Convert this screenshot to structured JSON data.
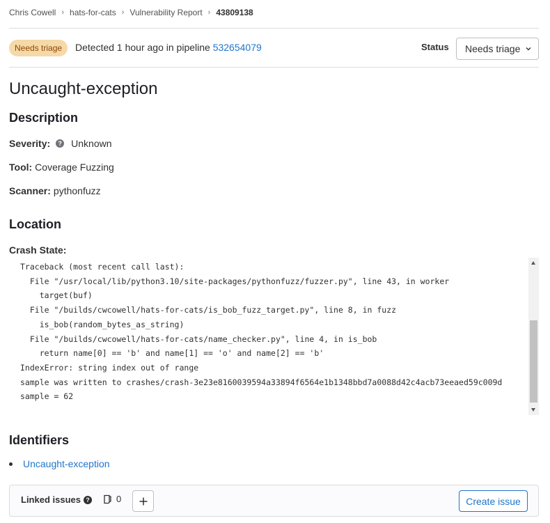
{
  "breadcrumb": [
    "Chris Cowell",
    "hats-for-cats",
    "Vulnerability Report",
    "43809138"
  ],
  "header": {
    "badge": "Needs triage",
    "detected_prefix": "Detected 1 hour ago in pipeline",
    "pipeline_id": "532654079",
    "status_label": "Status",
    "status_value": "Needs triage"
  },
  "title": "Uncaught-exception",
  "description": {
    "heading": "Description",
    "severity_label": "Severity:",
    "severity_value": "Unknown",
    "tool_label": "Tool:",
    "tool_value": "Coverage Fuzzing",
    "scanner_label": "Scanner:",
    "scanner_value": "pythonfuzz"
  },
  "location": {
    "heading": "Location",
    "crash_state_label": "Crash State:",
    "crash_state": "Traceback (most recent call last):\n  File \"/usr/local/lib/python3.10/site-packages/pythonfuzz/fuzzer.py\", line 43, in worker\n    target(buf)\n  File \"/builds/cwcowell/hats-for-cats/is_bob_fuzz_target.py\", line 8, in fuzz\n    is_bob(random_bytes_as_string)\n  File \"/builds/cwcowell/hats-for-cats/name_checker.py\", line 4, in is_bob\n    return name[0] == 'b' and name[1] == 'o' and name[2] == 'b'\nIndexError: string index out of range\nsample was written to crashes/crash-3e23e8160039594a33894f6564e1b1348bbd7a0088d42c4acb73eeaed59c009d\nsample = 62"
  },
  "identifiers": {
    "heading": "Identifiers",
    "items": [
      "Uncaught-exception"
    ]
  },
  "linked_issues": {
    "label": "Linked issues",
    "count": "0",
    "create_label": "Create issue"
  },
  "icons": {
    "severity": "question-icon",
    "linked_help": "question-icon",
    "issues": "issues-icon",
    "add": "plus-icon",
    "dropdown": "chevron-down-icon"
  }
}
